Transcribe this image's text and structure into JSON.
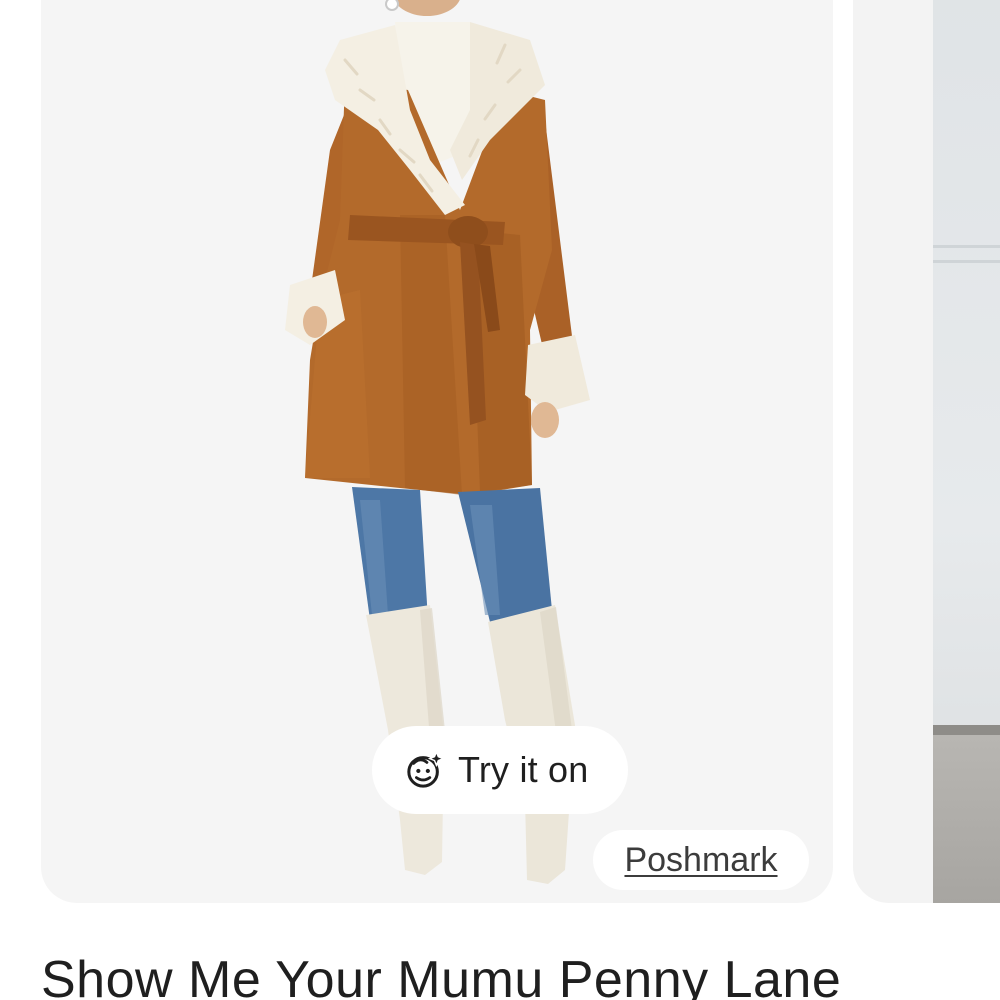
{
  "product": {
    "title": "Show Me Your Mumu Penny Lane",
    "image_icon": "coat-model-photo"
  },
  "try_on": {
    "label": "Try it on",
    "icon": "face-sparkle-icon"
  },
  "source": {
    "label": "Poshmark"
  },
  "colors": {
    "card_bg": "#f5f5f5",
    "coat": "#b36a2b",
    "fur": "#f4efe3",
    "jeans": "#4d77a6",
    "boots": "#ede8dc",
    "text": "#1f1f1f"
  }
}
